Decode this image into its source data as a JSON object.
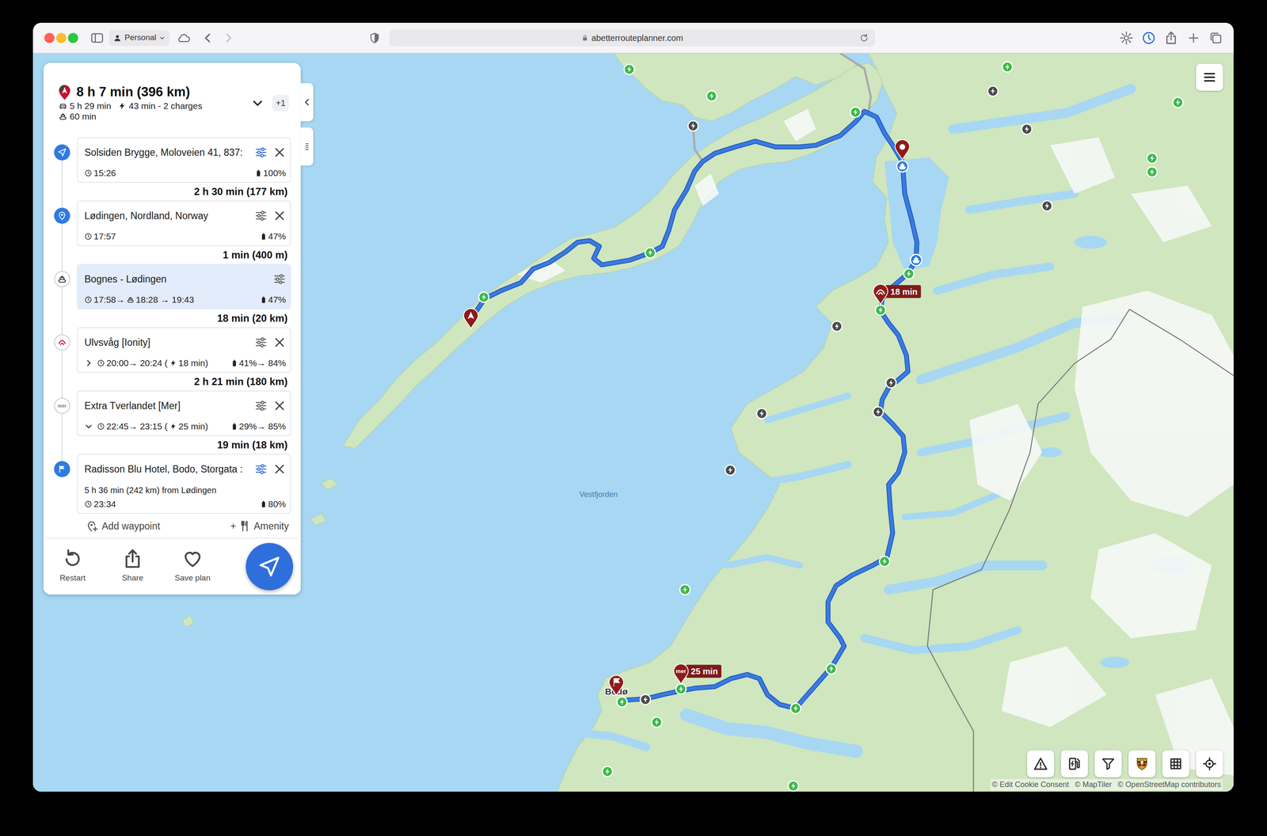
{
  "browser": {
    "profile": "Personal",
    "url": "abetterrouteplanner.com",
    "back_enabled": true,
    "forward_enabled": false
  },
  "plan": {
    "title": "8 h 7 min (396 km)",
    "drive_time": "5 h 29 min",
    "charge_summary": "43 min - 2 charges",
    "ferry_time": "60 min",
    "alternatives": "+1",
    "expanded": false
  },
  "stops": [
    {
      "kind": "origin",
      "name": "Solsiden Brygge, Moloveien 41, 837:",
      "time": "15:26",
      "battery": "100%",
      "settings_active": true,
      "selected": false
    },
    {
      "kind": "waypoint",
      "name": "Lødingen, Nordland, Norway",
      "time": "17:57",
      "battery": "47%",
      "settings_active": false,
      "selected": false
    },
    {
      "kind": "ferry",
      "name": "Bognes - Lødingen",
      "time": "17:58→",
      "ferry_time": "18:28 → 19:43",
      "battery": "47%",
      "settings_active": false,
      "selected": true
    },
    {
      "kind": "ionity",
      "name": "Ulvsvåg [Ionity]",
      "time": "20:00→ 20:24 (",
      "charge_time": "18 min)",
      "battery": "41%→ 84%",
      "settings_active": false,
      "expanded": false,
      "selected": false
    },
    {
      "kind": "mer",
      "logo": "mer",
      "name": "Extra Tverlandet [Mer]",
      "time": "22:45→ 23:15 (",
      "charge_time": "25 min)",
      "battery": "29%→ 85%",
      "settings_active": false,
      "expanded": true,
      "selected": false
    },
    {
      "kind": "destination",
      "name": "Radisson Blu Hotel, Bodo, Storgata :",
      "summary": "5 h 36 min (242 km) from Lødingen",
      "time": "23:34",
      "battery": "80%",
      "settings_active": true,
      "selected": false
    }
  ],
  "legs": [
    "2 h 30 min (177 km)",
    "1 min (400 m)",
    "18 min (20 km)",
    "2 h 21 min (180 km)",
    "19 min (18 km)"
  ],
  "add_waypoint": "Add waypoint",
  "amenity": {
    "prefix": "+",
    "label": "Amenity"
  },
  "actions": [
    "Restart",
    "Share",
    "Save plan"
  ],
  "map": {
    "sea_label": "Vestfjorden",
    "place_label": "Bodø",
    "pins": [
      {
        "kind": "origin"
      },
      {
        "kind": "waypoint"
      },
      {
        "kind": "ionity",
        "label": "18 min"
      },
      {
        "kind": "mer",
        "logo": "mer",
        "label": "25 min"
      },
      {
        "kind": "destination"
      }
    ],
    "ferries": [
      {
        "kind": "ferry"
      },
      {
        "kind": "ferry"
      }
    ],
    "chargers": [
      {
        "color": "#3cb94a"
      },
      {
        "color": "#3cb94a"
      },
      {
        "color": "#4a4a4a"
      },
      {
        "color": "#3cb94a"
      },
      {
        "color": "#4a4a4a"
      },
      {
        "color": "#3cb94a"
      },
      {
        "color": "#4a4a4a"
      },
      {
        "color": "#3cb94a"
      },
      {
        "color": "#3cb94a"
      },
      {
        "color": "#3cb94a"
      },
      {
        "color": "#4a4a4a"
      },
      {
        "color": "#3cb94a"
      },
      {
        "color": "#3cb94a"
      },
      {
        "color": "#3cb94a"
      },
      {
        "color": "#3cb94a"
      },
      {
        "color": "#4a4a4a"
      },
      {
        "color": "#4a4a4a"
      },
      {
        "color": "#4a4a4a"
      },
      {
        "color": "#4a4a4a"
      },
      {
        "color": "#4a4a4a"
      },
      {
        "color": "#3cb94a"
      },
      {
        "color": "#3cb94a"
      },
      {
        "color": "#3cb94a"
      },
      {
        "color": "#3cb94a"
      },
      {
        "color": "#3cb94a"
      },
      {
        "color": "#4a4a4a"
      },
      {
        "color": "#3cb94a"
      },
      {
        "color": "#3cb94a"
      },
      {
        "color": "#3cb94a"
      },
      {
        "color": "#3cb94a"
      }
    ],
    "attribution": [
      "© Edit Cookie Consent",
      "© MapTiler",
      "© OpenStreetMap contributors"
    ]
  }
}
